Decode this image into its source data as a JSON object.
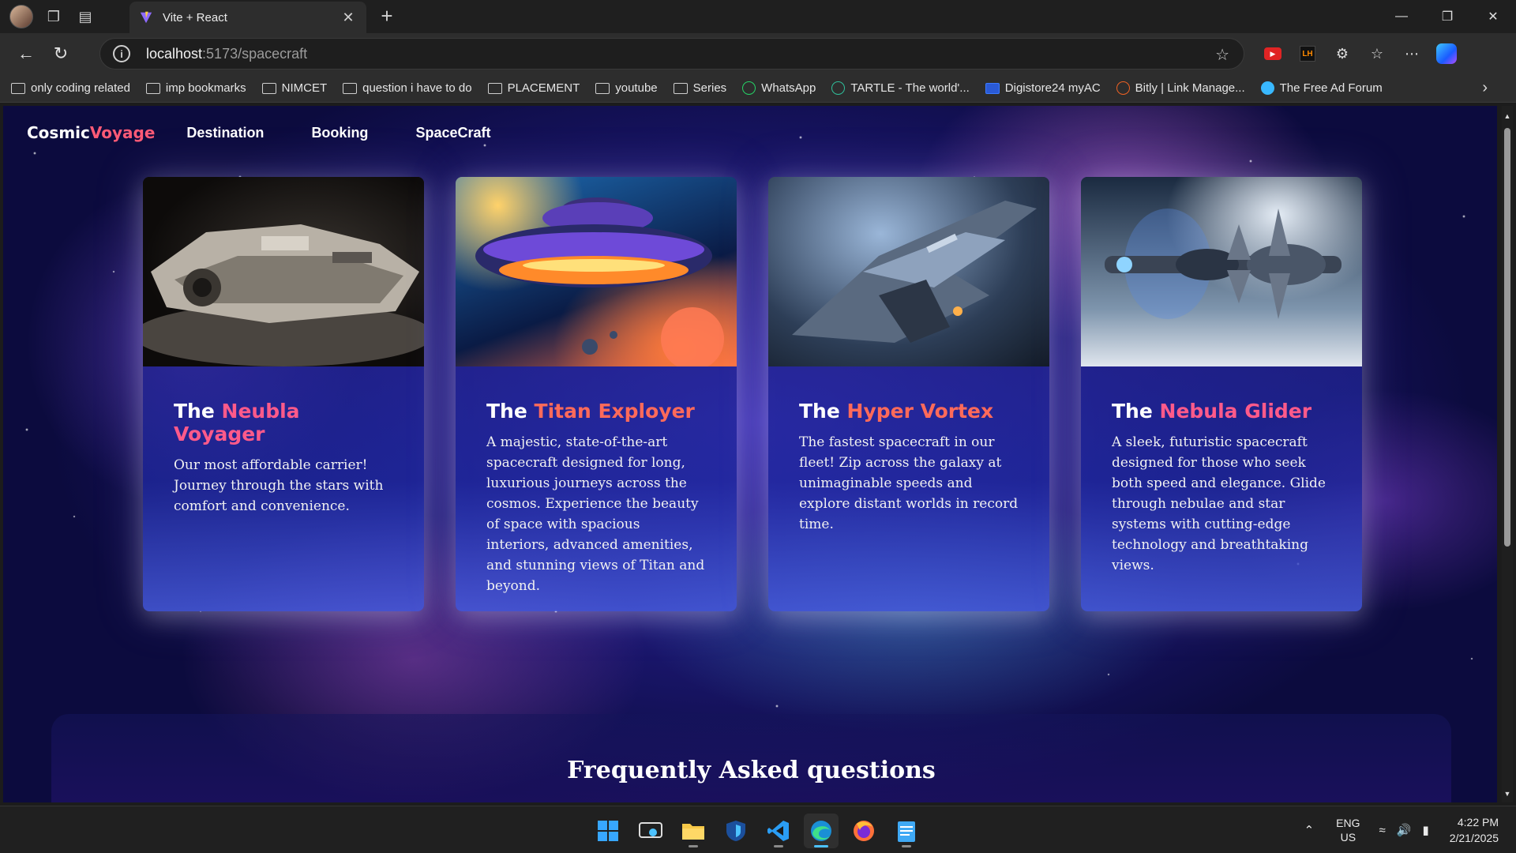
{
  "browser": {
    "tab_title": "Vite + React",
    "url_host": "localhost",
    "url_path": ":5173/spacecraft",
    "bookmarks": [
      {
        "label": "only coding  related",
        "icon": "folder-icon"
      },
      {
        "label": "imp bookmarks",
        "icon": "folder-icon"
      },
      {
        "label": "NIMCET",
        "icon": "folder-icon"
      },
      {
        "label": "question i have to do",
        "icon": "folder-icon"
      },
      {
        "label": "PLACEMENT",
        "icon": "folder-icon"
      },
      {
        "label": "youtube",
        "icon": "folder-icon"
      },
      {
        "label": "Series",
        "icon": "folder-icon"
      },
      {
        "label": "WhatsApp",
        "icon": "whatsapp-icon"
      },
      {
        "label": "TARTLE - The world'...",
        "icon": "tartle-icon"
      },
      {
        "label": "Digistore24 myAC",
        "icon": "digistore-icon"
      },
      {
        "label": "Bitly | Link Manage...",
        "icon": "bitly-icon"
      },
      {
        "label": "The Free Ad Forum",
        "icon": "forum-icon"
      }
    ]
  },
  "site": {
    "logo_part1": "Cosmic",
    "logo_part2": "Voyage",
    "nav": [
      "Destination",
      "Booking",
      "SpaceCraft"
    ]
  },
  "cards": [
    {
      "title_plain": "The ",
      "title_highlight": "Neubla Voyager",
      "description": "Our most affordable carrier! Journey through the stars with comfort and convenience."
    },
    {
      "title_plain": "The ",
      "title_highlight": "Titan Exployer",
      "description": "A majestic, state-of-the-art spacecraft designed for long, luxurious journeys across the cosmos. Experience the beauty of space with spacious interiors, advanced amenities, and stunning views of Titan and beyond."
    },
    {
      "title_plain": "The ",
      "title_highlight": "Hyper Vortex",
      "description": "The fastest spacecraft in our fleet! Zip across the galaxy at unimaginable speeds and explore distant worlds in record time."
    },
    {
      "title_plain": "The ",
      "title_highlight": "Nebula Glider",
      "description": "A sleek, futuristic spacecraft designed for those who seek both speed and elegance. Glide through nebulae and star systems with cutting-edge technology and breathtaking views."
    }
  ],
  "faq": {
    "title": "Frequently Asked questions"
  },
  "taskbar": {
    "lang_line1": "ENG",
    "lang_line2": "US",
    "time": "4:22 PM",
    "date": "2/21/2025"
  },
  "colors": {
    "accent_red": "#ff6a5a",
    "accent_pink": "#ff5a8a",
    "logo_pink": "#ff5a76",
    "logo_violet": "#9a8cff"
  }
}
